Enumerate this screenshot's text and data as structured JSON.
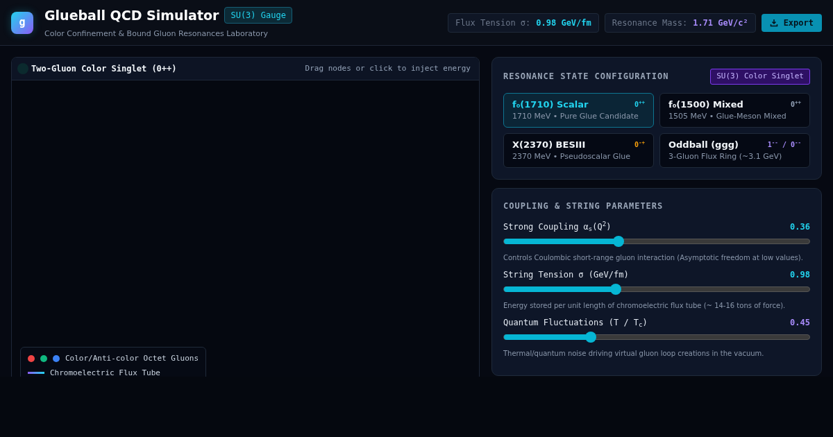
{
  "header": {
    "logo": "g",
    "title": "Glueball QCD Simulator",
    "badge": "SU(3) Gauge",
    "subtitle": "Color Confinement & Bound Gluon Resonances Laboratory",
    "stats": [
      {
        "label": "Flux Tension σ:",
        "value": "0.98 GeV/fm",
        "color": "#22d3ee"
      },
      {
        "label": "Resonance Mass:",
        "value": "1.71 GeV/c²",
        "color": "#a78bfa"
      }
    ],
    "export_button": "Export"
  },
  "canvas": {
    "title": "Two-Gluon Color Singlet (0++)",
    "hint": "Drag nodes or click to inject energy",
    "legend": [
      {
        "kind": "dots",
        "label": "Color/Anti-color Octet Gluons",
        "dots": [
          {
            "color": "#ef4444"
          },
          {
            "color": "#10b981"
          },
          {
            "color": "#3b82f6"
          }
        ]
      },
      {
        "kind": "line",
        "label": "Chromoelectric Flux Tube"
      }
    ]
  },
  "resonances": {
    "title": "RESONANCE STATE CONFIGURATION",
    "badge": "SU(3) Color Singlet",
    "states": [
      {
        "name": "f₀(1710) Scalar",
        "quantum": "0$^{++}$",
        "color": "#22d3ee",
        "detail": "1710 MeV • Pure Glue Candidate",
        "selected": true
      },
      {
        "name": "f₀(1500) Mixed",
        "quantum": "0$^{++}$",
        "color": "#94a3b8",
        "detail": "1505 MeV • Glue-Meson Mixed",
        "selected": false
      },
      {
        "name": "X(2370) BESIII",
        "quantum": "0$^{-+}$",
        "color": "#f59e0b",
        "detail": "2370 MeV • Pseudoscalar Glue",
        "selected": false
      },
      {
        "name": "Oddball (ggg)",
        "quantum": "1$^{--}$ / 0$^{--}$",
        "color": "#a78bfa",
        "detail": "3-Gluon Flux Ring (~3.1 GeV)",
        "selected": false
      }
    ]
  },
  "parameters": {
    "title": "COUPLING & STRING PARAMETERS",
    "sliders": [
      {
        "label": "Strong Coupling α$_{s}$(Q$^{2}$)",
        "reading": "0.36",
        "color": "#22d3ee",
        "level": 0.374,
        "description": "Controls Coulombic short-range gluon interaction (Asymptotic freedom at low values)."
      },
      {
        "label": "String Tension σ (GeV/fm)",
        "reading": "0.98",
        "color": "#22d3ee",
        "level": 0.367,
        "description": "Energy stored per unit length of chromoelectric flux tube (~ 14-16 tons of force)."
      },
      {
        "label": "Quantum Fluctuations (T / T$_{c}$)",
        "reading": "0.45",
        "color": "#a78bfa",
        "level": 0.283,
        "description": "Thermal/quantum noise driving virtual gluon loop creations in the vacuum."
      }
    ]
  }
}
